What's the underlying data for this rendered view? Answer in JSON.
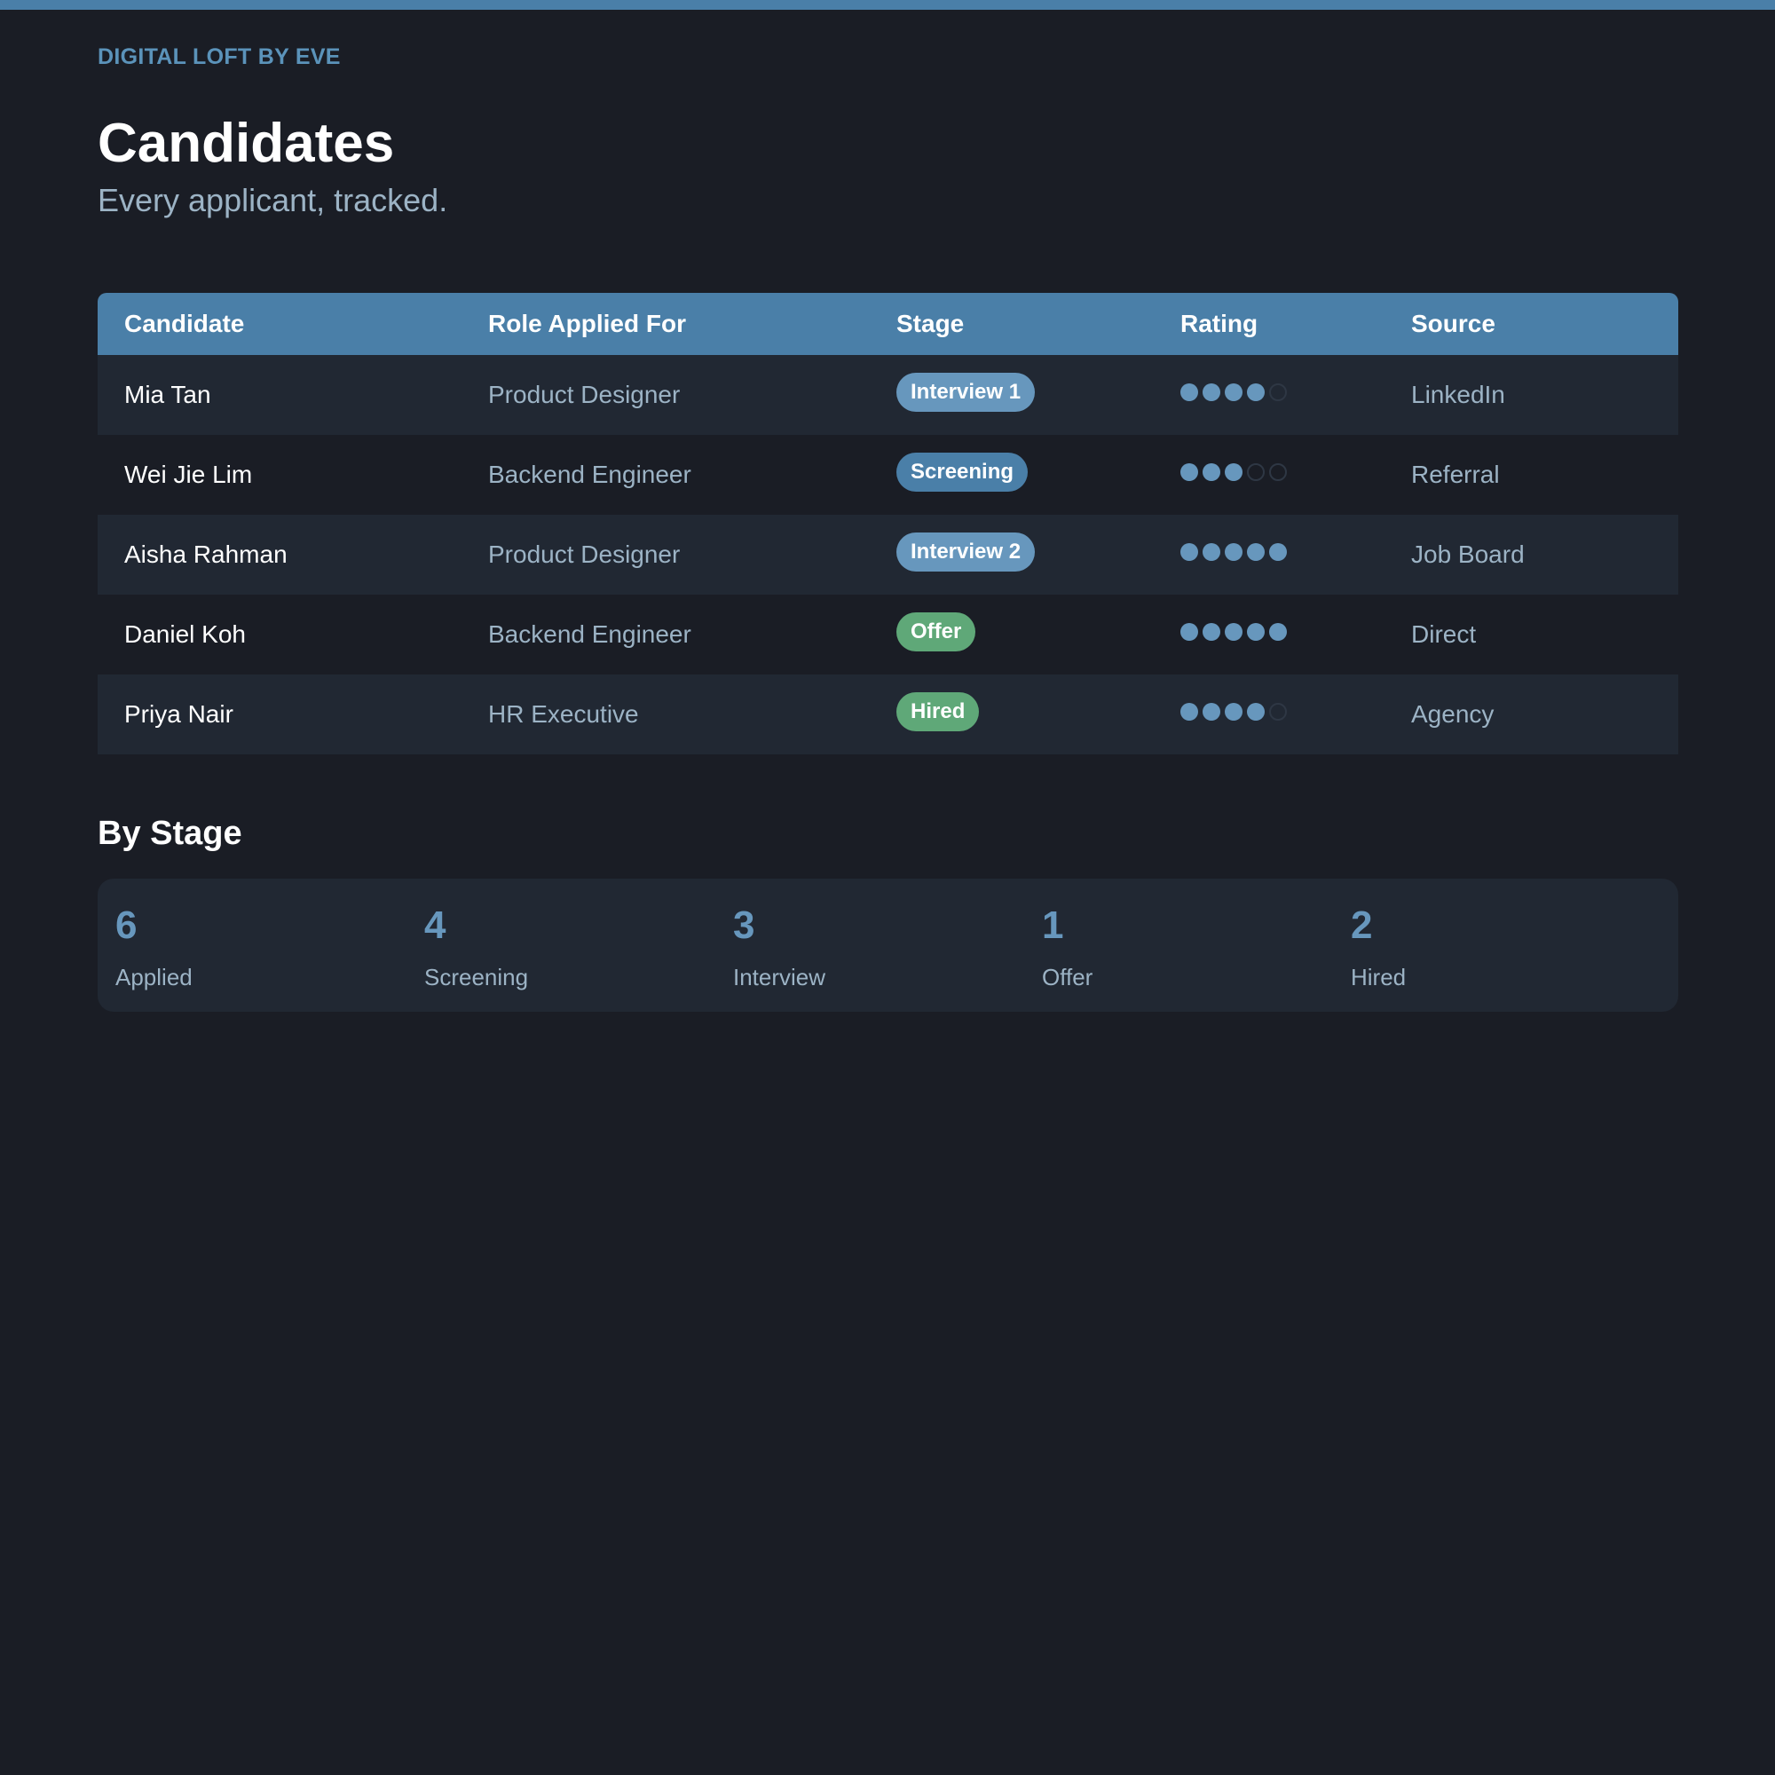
{
  "brand": "DIGITAL LOFT BY EVE",
  "title": "Candidates",
  "subtitle": "Every applicant, tracked.",
  "table": {
    "headers": [
      "Candidate",
      "Role Applied For",
      "Stage",
      "Rating",
      "Source"
    ],
    "rows": [
      {
        "name": "Mia Tan",
        "role": "Product Designer",
        "stage": "Interview 1",
        "stage_kind": "interview",
        "rating": 4,
        "source": "LinkedIn"
      },
      {
        "name": "Wei Jie Lim",
        "role": "Backend Engineer",
        "stage": "Screening",
        "stage_kind": "screening",
        "rating": 3,
        "source": "Referral"
      },
      {
        "name": "Aisha Rahman",
        "role": "Product Designer",
        "stage": "Interview 2",
        "stage_kind": "interview",
        "rating": 5,
        "source": "Job Board"
      },
      {
        "name": "Daniel Koh",
        "role": "Backend Engineer",
        "stage": "Offer",
        "stage_kind": "offer",
        "rating": 5,
        "source": "Direct"
      },
      {
        "name": "Priya Nair",
        "role": "HR Executive",
        "stage": "Hired",
        "stage_kind": "hired",
        "rating": 4,
        "source": "Agency"
      }
    ],
    "rating_max": 5
  },
  "by_stage": {
    "title": "By Stage",
    "items": [
      {
        "count": "6",
        "label": "Applied"
      },
      {
        "count": "4",
        "label": "Screening"
      },
      {
        "count": "3",
        "label": "Interview"
      },
      {
        "count": "1",
        "label": "Offer"
      },
      {
        "count": "2",
        "label": "Hired"
      }
    ]
  },
  "colors": {
    "accent": "#4a7fa8",
    "accent_light": "#6797bd",
    "success": "#5fa878",
    "background": "#1a1d25",
    "surface": "#212833",
    "muted_text": "#9cb3c5"
  }
}
